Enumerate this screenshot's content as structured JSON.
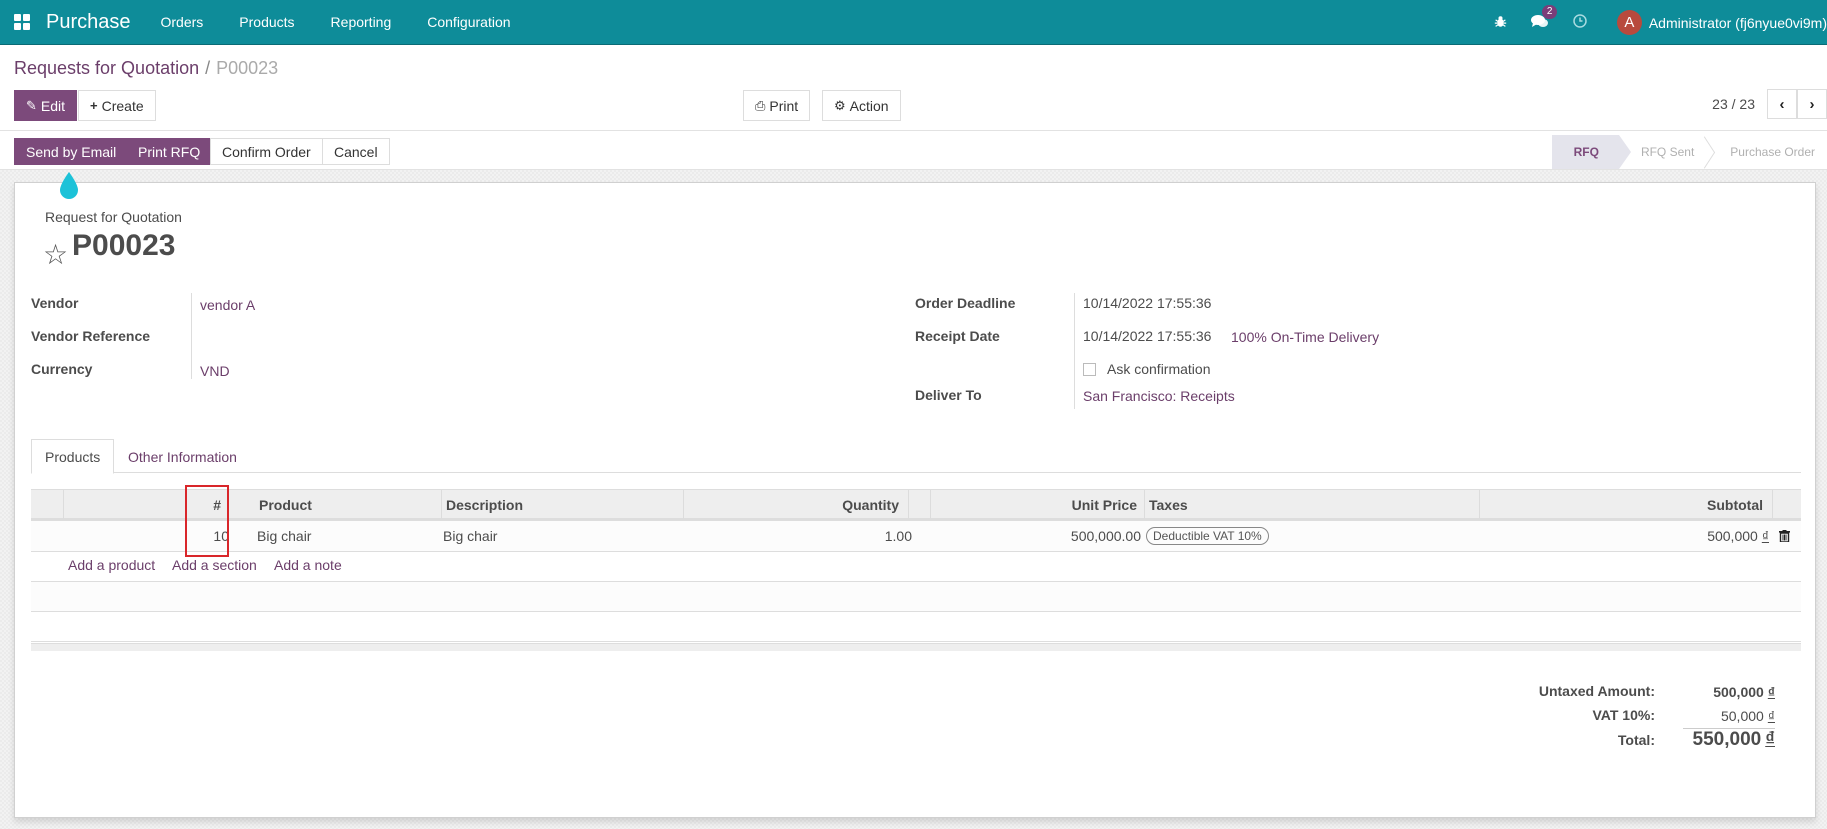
{
  "topbar": {
    "app_name": "Purchase",
    "menu": [
      "Orders",
      "Products",
      "Reporting",
      "Configuration"
    ],
    "icons": {
      "apps": "apps-grid-icon",
      "debug": "bug-icon",
      "messages": "chat-icon",
      "activity": "clock-icon"
    },
    "message_count": "2",
    "avatar_letter": "A",
    "user_name": "Administrator (fj6nyue0vi9m)"
  },
  "breadcrumb": {
    "parent": "Requests for Quotation",
    "separator": "/",
    "current": "P00023"
  },
  "toolbar": {
    "edit_label": "Edit",
    "create_label": "Create",
    "print_label": "Print",
    "action_label": "Action",
    "pager": "23 / 23",
    "prev": "‹",
    "next": "›"
  },
  "action_buttons": {
    "send_email": "Send by Email",
    "print_rfq": "Print RFQ",
    "confirm": "Confirm Order",
    "cancel": "Cancel"
  },
  "status": {
    "steps": [
      "RFQ",
      "RFQ Sent",
      "Purchase Order"
    ],
    "active": "RFQ"
  },
  "form": {
    "doc_type": "Request for Quotation",
    "name": "P00023",
    "left_fields": [
      {
        "label": "Vendor",
        "value": "vendor A"
      },
      {
        "label": "Vendor Reference",
        "value": ""
      },
      {
        "label": "Currency",
        "value": "VND"
      }
    ],
    "right_fields": {
      "order_deadline_label": "Order Deadline",
      "order_deadline": "10/14/2022 17:55:36",
      "receipt_date_label": "Receipt Date",
      "receipt_date": "10/14/2022 17:55:36",
      "on_time": "100% On-Time Delivery",
      "ask_confirmation": "Ask confirmation",
      "ask_confirmation_checked": false,
      "deliver_to_label": "Deliver To",
      "deliver_to": "San Francisco: Receipts"
    }
  },
  "tabs": [
    "Products",
    "Other Information"
  ],
  "table": {
    "headers": {
      "seq": "#",
      "product": "Product",
      "description": "Description",
      "quantity": "Quantity",
      "unit_price": "Unit Price",
      "taxes": "Taxes",
      "subtotal": "Subtotal"
    },
    "rows": [
      {
        "seq": "10",
        "product": "Big chair",
        "description": "Big chair",
        "quantity": "1.00",
        "unit_price": "500,000.00",
        "tax": "Deductible VAT 10%",
        "subtotal": "500,000",
        "currency": "₫"
      }
    ],
    "add_product": "Add a product",
    "add_section": "Add a section",
    "add_note": "Add a note"
  },
  "totals": {
    "untaxed_label": "Untaxed Amount:",
    "untaxed": "500,000",
    "vat_label": "VAT 10%:",
    "vat": "50,000",
    "total_label": "Total:",
    "total": "550,000",
    "currency": "₫"
  }
}
